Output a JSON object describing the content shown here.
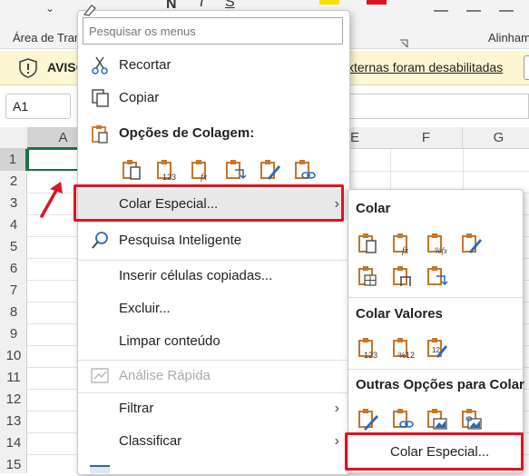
{
  "ribbon": {
    "clipboard_group_label": "Área de Tran",
    "alignment_group_label": "Alinham"
  },
  "warning": {
    "title": "AVISO",
    "message": "xternas foram desabilitadas"
  },
  "namebox": {
    "value": "A1"
  },
  "columns": [
    "A",
    "E",
    "F",
    "G"
  ],
  "rows": [
    "1",
    "2",
    "3",
    "4",
    "5",
    "6",
    "7",
    "8",
    "9",
    "10",
    "11",
    "12",
    "13",
    "14",
    "15"
  ],
  "context_menu": {
    "search_placeholder": "Pesquisar os menus",
    "items": {
      "cut": "Recortar",
      "copy": "Copiar",
      "paste_options_header": "Opções de Colagem:",
      "paste_special": "Colar Especial...",
      "smart_lookup": "Pesquisa Inteligente",
      "insert_copied": "Inserir células copiadas...",
      "delete": "Excluir...",
      "clear_contents": "Limpar conteúdo",
      "quick_analysis": "Análise Rápida",
      "filter": "Filtrar",
      "sort": "Classificar"
    }
  },
  "submenu": {
    "paste_header": "Colar",
    "paste_values_header": "Colar Valores",
    "other_options_header": "Outras Opções para Colar",
    "paste_special": "Colar Especial..."
  },
  "colors": {
    "highlight_red": "#e0141e",
    "clipboard_orange": "#c8742a",
    "excel_green": "#1e7145",
    "warning_bg": "#fdf6d3"
  }
}
